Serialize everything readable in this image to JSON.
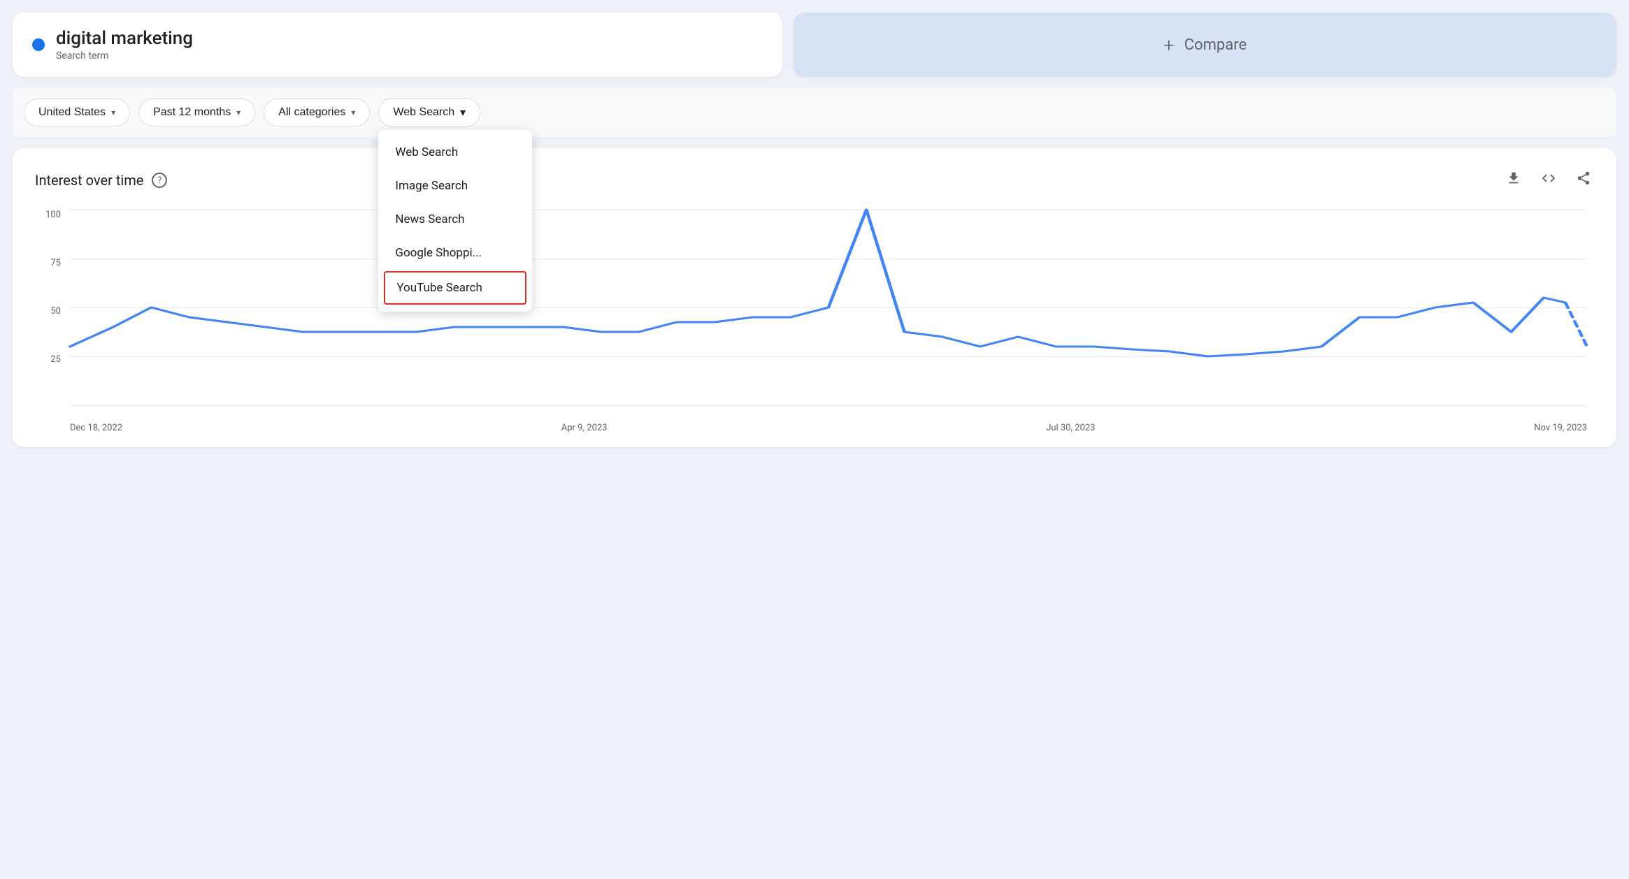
{
  "search": {
    "term": "digital marketing",
    "label": "Search term",
    "dot_color": "#1a73e8"
  },
  "compare": {
    "plus": "+",
    "label": "Compare"
  },
  "filters": {
    "location": {
      "label": "United States",
      "chevron": "▾"
    },
    "time": {
      "label": "Past 12 months",
      "chevron": "▾"
    },
    "categories": {
      "label": "All categories",
      "chevron": "▾"
    },
    "search_type": {
      "label": "Web Search",
      "chevron": "▾"
    }
  },
  "dropdown": {
    "items": [
      {
        "label": "Web Search",
        "selected": false
      },
      {
        "label": "Image Search",
        "selected": false
      },
      {
        "label": "News Search",
        "selected": false
      },
      {
        "label": "Google Shoppi...",
        "selected": false
      },
      {
        "label": "YouTube Search",
        "selected": true
      }
    ]
  },
  "chart": {
    "title": "Interest over time",
    "help_icon": "?",
    "y_labels": [
      "100",
      "75",
      "50",
      "25"
    ],
    "x_labels": [
      "Dec 18, 2022",
      "Apr 9, 2023",
      "Jul 30, 2023",
      "Nov 19, 2023"
    ],
    "download_icon": "⬇",
    "embed_icon": "<>",
    "share_icon": "↗"
  }
}
